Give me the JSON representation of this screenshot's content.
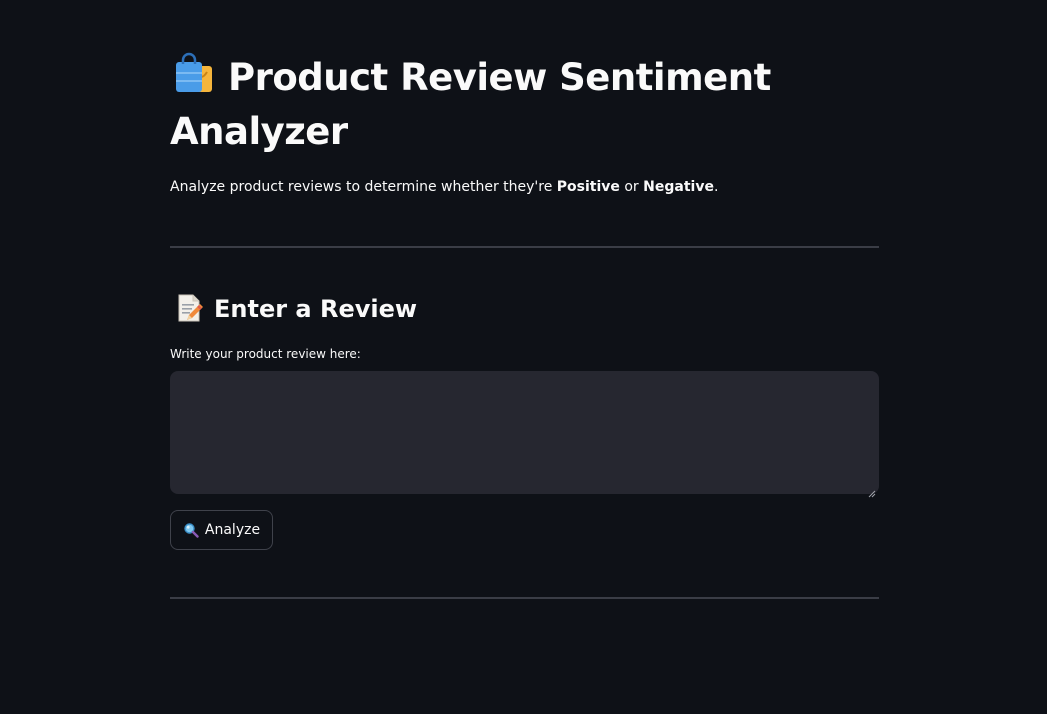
{
  "header": {
    "title": "Product Review Sentiment Analyzer",
    "title_icon": "shopping-bags-icon",
    "subtitle_prefix": "Analyze product reviews to determine whether they're ",
    "subtitle_positive": "Positive",
    "subtitle_or": " or ",
    "subtitle_negative": "Negative",
    "subtitle_suffix": "."
  },
  "review_section": {
    "heading": "Enter a Review",
    "heading_icon": "memo-icon",
    "input_label": "Write your product review here:",
    "input_value": "",
    "input_placeholder": ""
  },
  "actions": {
    "analyze_label": "Analyze",
    "analyze_icon": "magnifier-icon"
  },
  "colors": {
    "background": "#0e1117",
    "text": "#fafafa",
    "input_bg": "#262730",
    "divider": "#3a3d46"
  }
}
